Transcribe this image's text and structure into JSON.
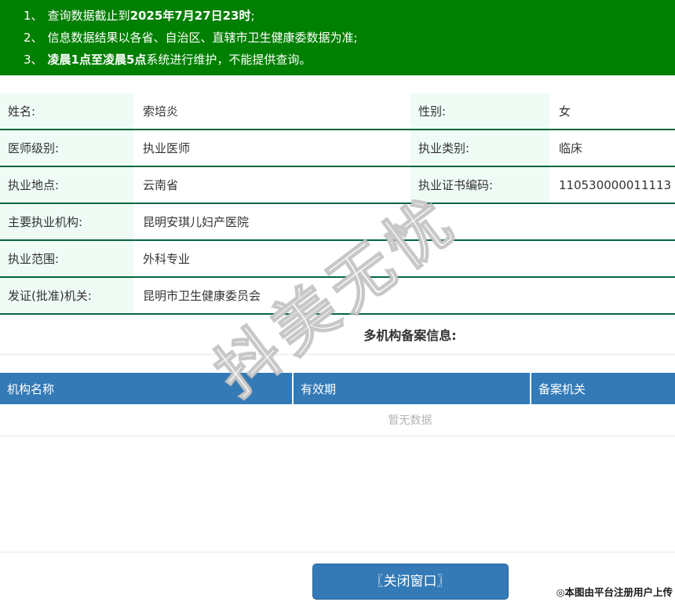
{
  "banner": {
    "bg_color": "#008000",
    "items": [
      {
        "num": "1、",
        "pre": "查询数据截止到",
        "bold": "2025年7月27日23时",
        "post": ";"
      },
      {
        "num": "2、",
        "pre": "信息数据结果以各省、自治区、直辖市卫生健康委数据为准;",
        "bold": "",
        "post": ""
      },
      {
        "num": "3、",
        "pre": "",
        "bold": "凌晨1点至凌晨5点",
        "post": "系统进行维护，不能提供查询。"
      }
    ]
  },
  "info": {
    "rows": [
      {
        "label1": "姓名:",
        "value1": "索培炎",
        "label2": "性别:",
        "value2": "女"
      },
      {
        "label1": "医师级别:",
        "value1": "执业医师",
        "label2": "执业类别:",
        "value2": "临床"
      },
      {
        "label1": "执业地点:",
        "value1": "云南省",
        "label2": "执业证书编码:",
        "value2": "110530000011113"
      },
      {
        "label1": "主要执业机构:",
        "value1": "昆明安琪儿妇产医院"
      },
      {
        "label1": "执业范围:",
        "value1": "外科专业"
      },
      {
        "label1": "发证(批准)机关:",
        "value1": "昆明市卫生健康委员会"
      }
    ],
    "label_bg_color": "#effbf5",
    "divider_color": "#04663e"
  },
  "section": {
    "title": "多机构备案信息:"
  },
  "records_table": {
    "headers": [
      "机构名称",
      "有效期",
      "备案机关"
    ],
    "header_bg_color": "#337ab7",
    "empty_text": "暂无数据",
    "rows": []
  },
  "footer": {
    "close_button_label": "〖关闭窗口〗",
    "button_color": "#337ab7",
    "upload_note": "◎本图由平台注册用户上传"
  },
  "watermark": {
    "text": "抖美无忧"
  }
}
